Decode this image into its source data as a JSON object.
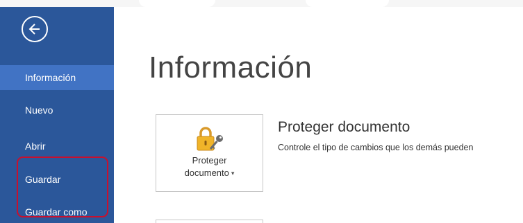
{
  "sidebar": {
    "back_icon": "back-arrow-icon",
    "items": [
      {
        "label": "Información",
        "active": true
      },
      {
        "label": "Nuevo",
        "active": false
      },
      {
        "label": "Abrir",
        "active": false
      },
      {
        "label": "Guardar",
        "active": false
      },
      {
        "label": "Guardar como",
        "active": false
      }
    ],
    "highlight_color": "#c8102e",
    "background_color": "#2b579a",
    "active_color": "#4173c4"
  },
  "main": {
    "title": "Información",
    "protect": {
      "tile_line1": "Proteger",
      "tile_line2": "documento",
      "icon": "lock-key-icon",
      "heading": "Proteger documento",
      "description": "Controle el tipo de cambios que los demás pueden"
    }
  }
}
